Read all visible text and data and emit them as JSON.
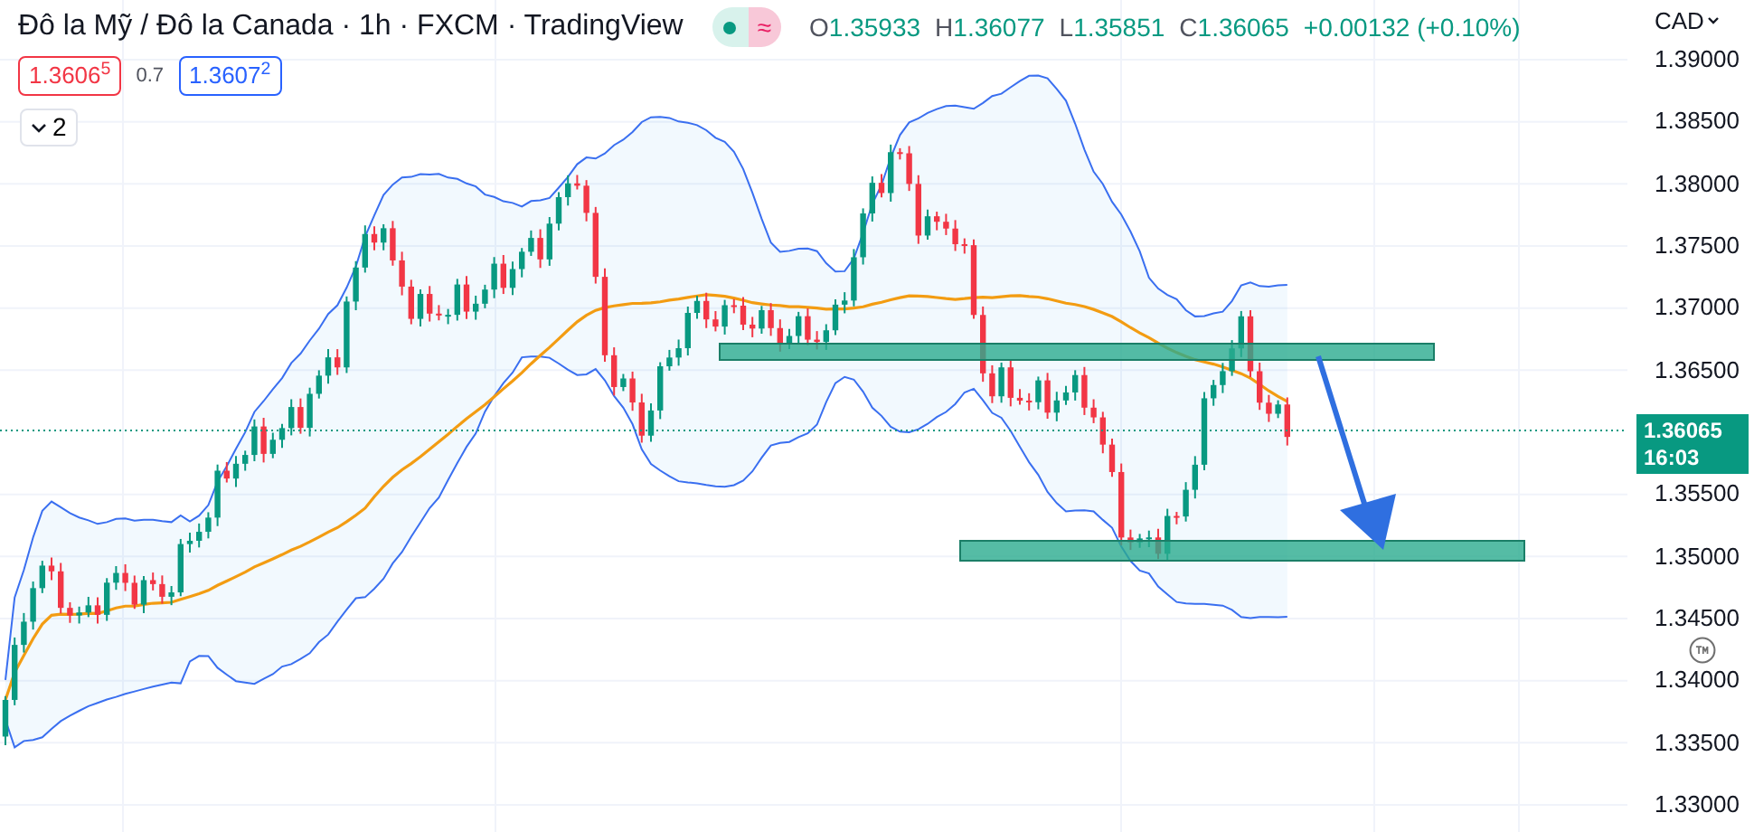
{
  "title": "Đô la Mỹ / Đô la Canada · 1h · FXCM · TradingView",
  "data_status_glyph": "≈",
  "ohlc": [
    {
      "label": "O",
      "value": "1.35933"
    },
    {
      "label": "H",
      "value": "1.36077"
    },
    {
      "label": "L",
      "value": "1.35851"
    },
    {
      "label": "C",
      "value": "1.36065"
    }
  ],
  "change": "+0.00132 (+0.10%)",
  "sell_price": "1.3606$^{5}$",
  "spread": "0.7",
  "buy_price": "1.3607$^{2}$",
  "indicators_toggle": "2",
  "currency": "CAD",
  "price_axis": [
    "1.39000",
    "1.38500",
    "1.38000",
    "1.37500",
    "1.37000",
    "1.36500",
    "1.35500",
    "1.35000",
    "1.34500",
    "1.34000",
    "1.33500",
    "1.33000"
  ],
  "last_price": {
    "value": "1.36065",
    "countdown": "16:03"
  }
}
